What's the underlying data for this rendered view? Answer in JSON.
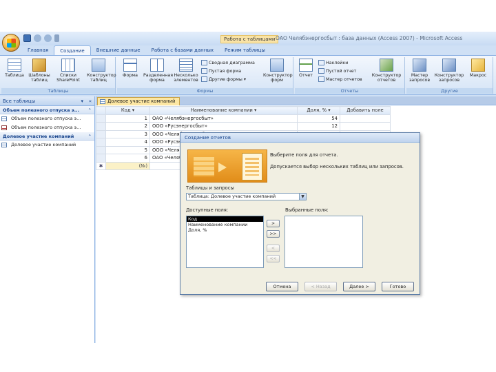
{
  "window": {
    "title": "ОАО Челябэнергосбыт : база данных (Access 2007) - Microsoft Access",
    "context_tab": "Работа с таблицами"
  },
  "ribbon_tabs": [
    "Главная",
    "Создание",
    "Внешние данные",
    "Работа с базами данных",
    "Режим таблицы"
  ],
  "ribbon": {
    "groups": [
      "Таблицы",
      "Формы",
      "Отчеты",
      "Другие"
    ],
    "tables": [
      "Таблица",
      "Шаблоны таблиц",
      "Списки SharePoint",
      "Конструктор таблиц"
    ],
    "forms": [
      "Форма",
      "Разделенная форма",
      "Несколько элементов",
      "Конструктор форм"
    ],
    "forms_small": [
      "Сводная диаграмма",
      "Пустая форма",
      "Другие формы"
    ],
    "reports": [
      "Отчет",
      "Конструктор отчетов"
    ],
    "reports_small": [
      "Наклейки",
      "Пустой отчет",
      "Мастер отчетов"
    ],
    "other": [
      "Мастер запросов",
      "Конструктор запросов",
      "Макрос"
    ]
  },
  "nav": {
    "header": "Все таблицы",
    "groups": [
      {
        "title": "Объем полезного отпуска э...",
        "items": [
          "Объем полезного отпуска э...",
          "Объем полезного отпуска э..."
        ]
      },
      {
        "title": "Долевое участие компаний",
        "items": [
          "Долевое участие компаний"
        ]
      }
    ]
  },
  "document": {
    "tab": "Долевое участие компаний",
    "columns": [
      "Код",
      "Наименование компании",
      "Доля, %",
      "Добавить поле"
    ],
    "rows": [
      {
        "code": "1",
        "name": "ОАО «Челябэнергосбыт»",
        "share": "54"
      },
      {
        "code": "2",
        "name": "ООО «Русэнергосбыт»",
        "share": "12"
      },
      {
        "code": "3",
        "name": "ООО «Челябэнергосбыт»",
        "share": ""
      },
      {
        "code": "4",
        "name": "ООО «Русэнергосбыт»",
        "share": ""
      },
      {
        "code": "5",
        "name": "ООО «Челябэнергосбыт»",
        "share": ""
      },
      {
        "code": "6",
        "name": "ОАО «Челябэнергосбыт»",
        "share": ""
      }
    ],
    "new_row_code": "(№)"
  },
  "dialog": {
    "title": "Создание отчетов",
    "text1": "Выберите поля для отчета.",
    "text2": "Допускается выбор нескольких таблиц или запросов.",
    "tables_label": "Таблицы и запросы",
    "combo_value": "Таблица: Долевое участие компаний",
    "available_label": "Доступные поля:",
    "selected_label": "Выбранные поля:",
    "available_fields": [
      "Код",
      "Наименование компании",
      "Доля, %"
    ],
    "move_buttons": [
      ">",
      ">>",
      "<",
      "<<"
    ],
    "buttons": {
      "cancel": "Отмена",
      "back": "< Назад",
      "next": "Далее >",
      "finish": "Готово"
    }
  }
}
